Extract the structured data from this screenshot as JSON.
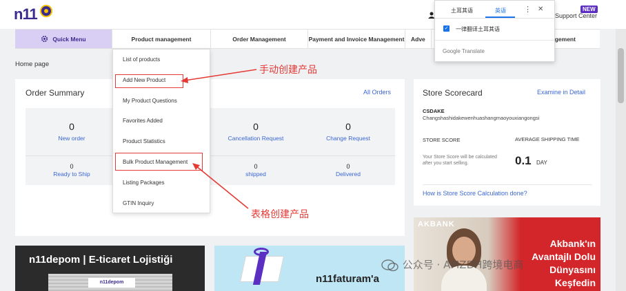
{
  "header": {
    "logo": "n11",
    "support_label": "Support Center",
    "new_badge": "NEW"
  },
  "nav": {
    "quick_menu": "Quick Menu",
    "product_management": "Product management",
    "order_management": "Order Management",
    "payment_invoice": "Payment and Invoice Management",
    "advertising_partial": "Adve",
    "management_partial": "agement"
  },
  "breadcrumb": "Home page",
  "dropdown": {
    "items": [
      "List of products",
      "Add New Product",
      "My Product Questions",
      "Favorites Added",
      "Product Statistics",
      "Bulk Product Management",
      "Listing Packages",
      "GTIN Inquiry"
    ]
  },
  "annotations": {
    "manual": "手动创建产品",
    "bulk": "表格创建产品",
    "color": "#e53935"
  },
  "order_summary": {
    "title": "Order Summary",
    "all_orders": "All Orders",
    "stats_row1": [
      {
        "value": "0",
        "label": "New order"
      },
      {
        "value": "0",
        "label": "Cancellation Request"
      },
      {
        "value": "0",
        "label": "Change Request"
      }
    ],
    "stats_row2": [
      {
        "value": "0",
        "label": "Ready to Ship"
      },
      {
        "value": "0",
        "label": "shipped"
      },
      {
        "value": "0",
        "label": "Delivered"
      }
    ]
  },
  "store": {
    "title": "Store Scorecard",
    "examine": "Examine in Detail",
    "name": "CSDAKE",
    "company": "Changshashidakewenhuashangmaoyouxiangongsi",
    "score_label": "STORE SCORE",
    "score_desc": "Your Store Score will be calculated after you start selling.",
    "shipping_label": "AVERAGE SHIPPING TIME",
    "shipping_value": "0.1",
    "shipping_unit": "DAY",
    "calc_link": "How is Store Score Calculation done?"
  },
  "banners": {
    "depom_title": "n11depom | E-ticaret Lojistiği",
    "depom_sign": "n11depom",
    "fatura_title": "n11faturam'a",
    "akbank_logo": "AKBANK",
    "akbank_text": "Akbank'ın Avantajlı Dolu Dünyasını Keşfedin"
  },
  "translate_popup": {
    "tab_source": "土耳其语",
    "tab_target": "英语",
    "more": "⋮",
    "close": "✕",
    "always_translate": "一律翻译土耳其语",
    "brand": "Google Translate"
  },
  "watermark": "公众号 · AMZDH跨境电商",
  "colors": {
    "brand_purple": "#5a2fc2",
    "link_blue": "#3a66d4",
    "accent_red": "#e53935",
    "akbank_red": "#d3262a"
  }
}
